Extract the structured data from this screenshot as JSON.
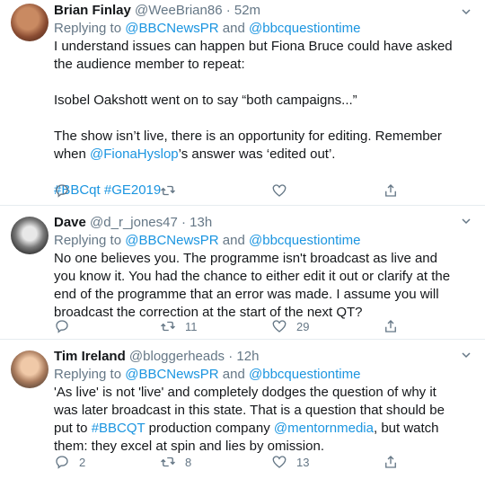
{
  "tweets": [
    {
      "name": "Brian Finlay",
      "handle": "@WeeBrian86",
      "dot": "·",
      "time": "52m",
      "reply_prefix": "Replying to ",
      "reply_user1": "@BBCNewsPR",
      "reply_and": " and ",
      "reply_user2": "@bbcquestiontime",
      "line1": "I understand issues can happen but Fiona Bruce could have asked the audience member to repeat:",
      "line2": "Isobel Oakshott went on to say “both campaigns...”",
      "line3": "The show isn’t live, there is an opportunity for editing. Remember when ",
      "line3_mention": "@FionaHyslop",
      "line3_tail": "’s answer was ‘edited out’.",
      "hashtags": "#BBCqt #GE2019",
      "reply_count": "",
      "retweet_count": "",
      "like_count": ""
    },
    {
      "name": "Dave",
      "handle": "@d_r_jones47",
      "dot": "·",
      "time": "13h",
      "reply_prefix": "Replying to ",
      "reply_user1": "@BBCNewsPR",
      "reply_and": " and ",
      "reply_user2": "@bbcquestiontime",
      "text": "No one believes you. The programme isn't broadcast as live and you know it. You had the chance to either edit it out or clarify at the end of the programme that an error was made. I assume you will broadcast the correction at the start of the next QT?",
      "reply_count": "",
      "retweet_count": "11",
      "like_count": "29"
    },
    {
      "name": "Tim Ireland",
      "handle": "@bloggerheads",
      "dot": "·",
      "time": "12h",
      "reply_prefix": "Replying to ",
      "reply_user1": "@BBCNewsPR",
      "reply_and": " and ",
      "reply_user2": "@bbcquestiontime",
      "text1": "'As live' is not 'live' and completely dodges the question of why it was later broadcast in this state. That is a question that should be put to ",
      "hashtag": "#BBCQT",
      "text2": " production company ",
      "mention": "@mentornmedia",
      "text3": ", but watch them: they excel at spin and lies by omission.",
      "reply_count": "2",
      "retweet_count": "8",
      "like_count": "13"
    }
  ],
  "colors": {
    "link": "#1b95e0",
    "muted": "#657786",
    "divider": "#e6ecf0"
  },
  "icons": [
    "reply-icon",
    "retweet-icon",
    "like-icon",
    "share-icon",
    "chevron-down-icon"
  ]
}
